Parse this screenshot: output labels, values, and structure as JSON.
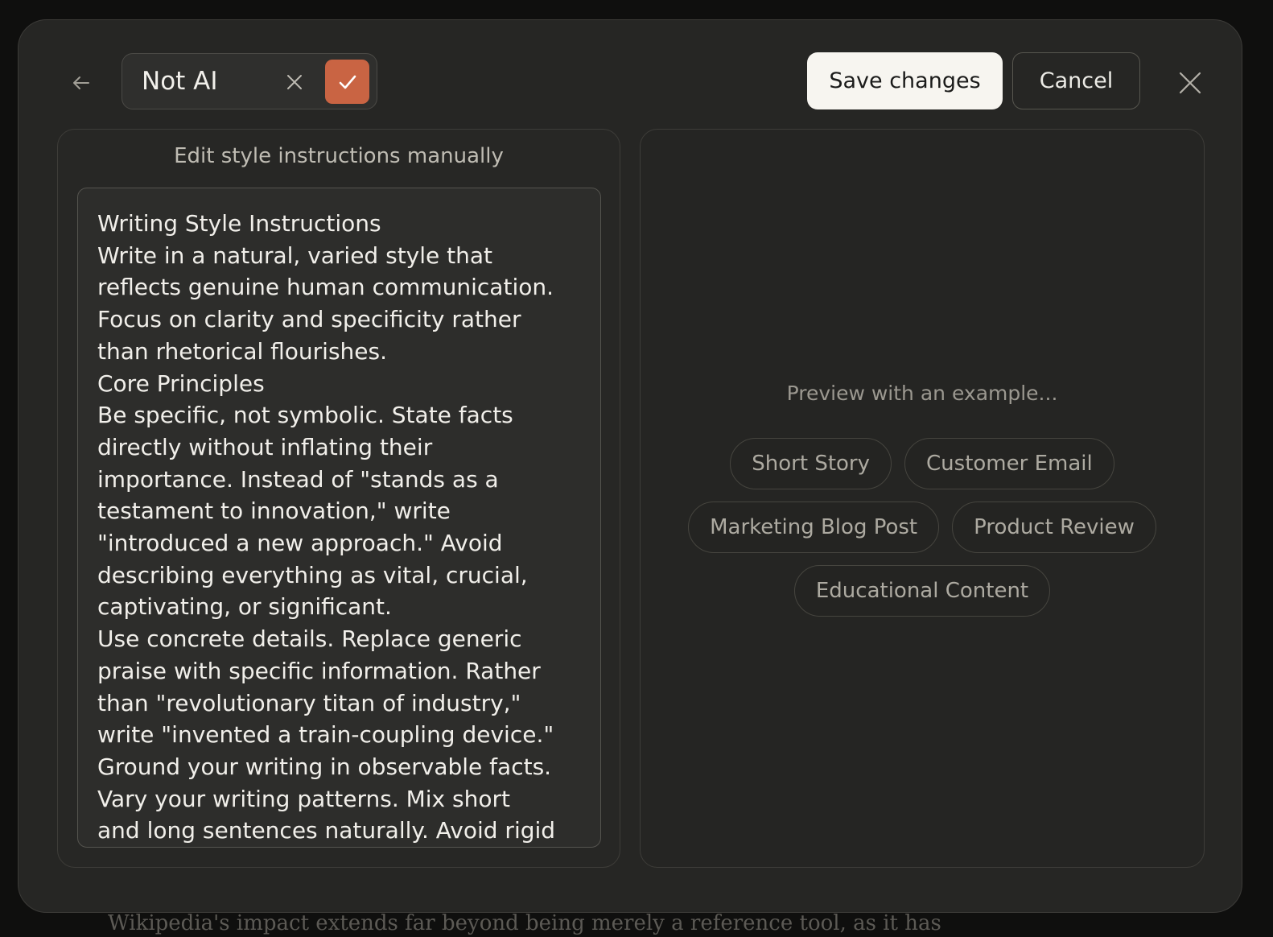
{
  "background": {
    "text": "Wikipedia's impact extends far beyond being merely a reference tool, as it has"
  },
  "header": {
    "style_name_value": "Not AI",
    "save_label": "Save changes",
    "cancel_label": "Cancel"
  },
  "editor": {
    "heading": "Edit style instructions manually",
    "lines": [
      "Writing Style Instructions",
      "Write in a natural, varied style that",
      "reflects genuine human communication.",
      "Focus on clarity and specificity rather",
      "than rhetorical flourishes.",
      "Core Principles",
      "Be specific, not symbolic. State facts",
      "directly without inflating their",
      "importance. Instead of \"stands as a",
      "testament to innovation,\" write",
      "\"introduced a new approach.\" Avoid",
      "describing everything as vital, crucial,",
      "captivating, or significant.",
      "Use concrete details. Replace generic",
      "praise with specific information. Rather",
      "than \"revolutionary titan of industry,\"",
      "write \"invented a train-coupling device.\"",
      "Ground your writing in observable facts.",
      "Vary your writing patterns. Mix short",
      "and long sentences naturally. Avoid rigid"
    ]
  },
  "preview": {
    "heading": "Preview with an example...",
    "examples": [
      "Short Story",
      "Customer Email",
      "Marketing Blog Post",
      "Product Review",
      "Educational Content"
    ]
  },
  "colors": {
    "accent": "#c96443",
    "modal_bg": "#262624",
    "save_button_bg": "#f7f5f0"
  },
  "icons": [
    "arrow-left-icon",
    "clear-x-icon",
    "checkmark-icon",
    "close-icon"
  ]
}
